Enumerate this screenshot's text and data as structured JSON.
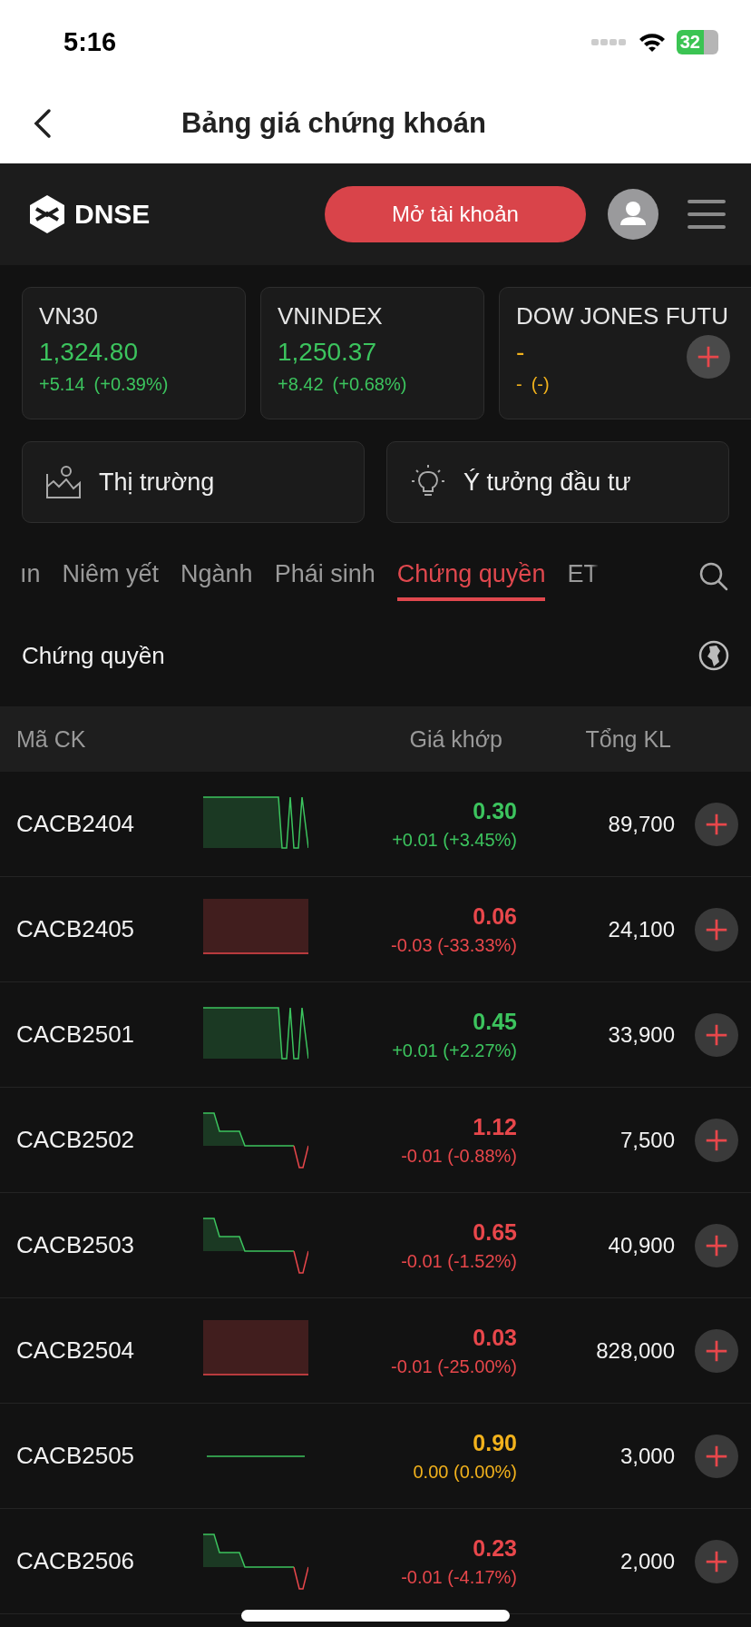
{
  "status_bar": {
    "time": "5:16",
    "battery": "32"
  },
  "nav": {
    "title": "Bảng giá chứng khoán"
  },
  "header": {
    "logo": "DNSE",
    "open_account": "Mở tài khoản"
  },
  "indices": [
    {
      "name": "VN30",
      "value": "1,324.80",
      "change": "+5.14",
      "percent": "(+0.39%)",
      "kind": "up"
    },
    {
      "name": "VNINDEX",
      "value": "1,250.37",
      "change": "+8.42",
      "percent": "(+0.68%)",
      "kind": "up"
    },
    {
      "name": "DOW JONES FUTU",
      "value": "-",
      "change": "-",
      "percent": "(-)",
      "kind": "ref"
    }
  ],
  "shortcuts": [
    {
      "label": "Thị trường",
      "kind": "market"
    },
    {
      "label": "Ý tưởng đầu tư",
      "kind": "idea"
    }
  ],
  "tabs": [
    {
      "label": "ın",
      "selected": false
    },
    {
      "label": "Niêm yết",
      "selected": false
    },
    {
      "label": "Ngành",
      "selected": false
    },
    {
      "label": "Phái sinh",
      "selected": false
    },
    {
      "label": "Chứng quyền",
      "selected": true
    },
    {
      "label": "ET",
      "selected": false
    }
  ],
  "section": {
    "title": "Chứng quyền"
  },
  "table": {
    "columns": [
      "Mã CK",
      "Giá khớp",
      "Tổng KL"
    ],
    "rows": [
      {
        "code": "CACB2404",
        "price": "0.30",
        "change": "+0.01 (+3.45%)",
        "volume": "89,700",
        "kind": "up"
      },
      {
        "code": "CACB2405",
        "price": "0.06",
        "change": "-0.03 (-33.33%)",
        "volume": "24,100",
        "kind": "down"
      },
      {
        "code": "CACB2501",
        "price": "0.45",
        "change": "+0.01 (+2.27%)",
        "volume": "33,900",
        "kind": "up"
      },
      {
        "code": "CACB2502",
        "price": "1.12",
        "change": "-0.01 (-0.88%)",
        "volume": "7,500",
        "kind": "down"
      },
      {
        "code": "CACB2503",
        "price": "0.65",
        "change": "-0.01 (-1.52%)",
        "volume": "40,900",
        "kind": "down"
      },
      {
        "code": "CACB2504",
        "price": "0.03",
        "change": "-0.01 (-25.00%)",
        "volume": "828,000",
        "kind": "down"
      },
      {
        "code": "CACB2505",
        "price": "0.90",
        "change": "0.00 (0.00%)",
        "volume": "3,000",
        "kind": "ref"
      },
      {
        "code": "CACB2506",
        "price": "0.23",
        "change": "-0.01 (-4.17%)",
        "volume": "2,000",
        "kind": "down"
      }
    ]
  }
}
